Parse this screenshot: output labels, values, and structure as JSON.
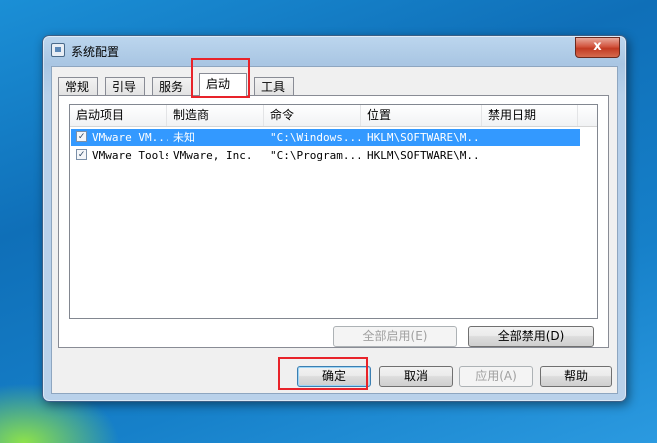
{
  "window": {
    "title": "系统配置",
    "close_label": "x"
  },
  "tabs": [
    {
      "label": "常规"
    },
    {
      "label": "引导"
    },
    {
      "label": "服务"
    },
    {
      "label": "启动"
    },
    {
      "label": "工具"
    }
  ],
  "list": {
    "columns": [
      "启动项目",
      "制造商",
      "命令",
      "位置",
      "禁用日期"
    ],
    "rows": [
      {
        "checked": "✓",
        "item": "VMware VM...",
        "maker": "未知",
        "command": "\"C:\\Windows...",
        "location": "HKLM\\SOFTWARE\\M...",
        "date": ""
      },
      {
        "checked": "✓",
        "item": "VMware Tools",
        "maker": "VMware, Inc.",
        "command": "\"C:\\Program...",
        "location": "HKLM\\SOFTWARE\\M...",
        "date": ""
      }
    ]
  },
  "buttons": {
    "enable_all": "全部启用(E)",
    "disable_all": "全部禁用(D)",
    "ok": "确定",
    "cancel": "取消",
    "apply": "应用(A)",
    "help": "帮助"
  },
  "colors": {
    "selection": "#3399ff",
    "highlight_border": "#e8232a"
  }
}
